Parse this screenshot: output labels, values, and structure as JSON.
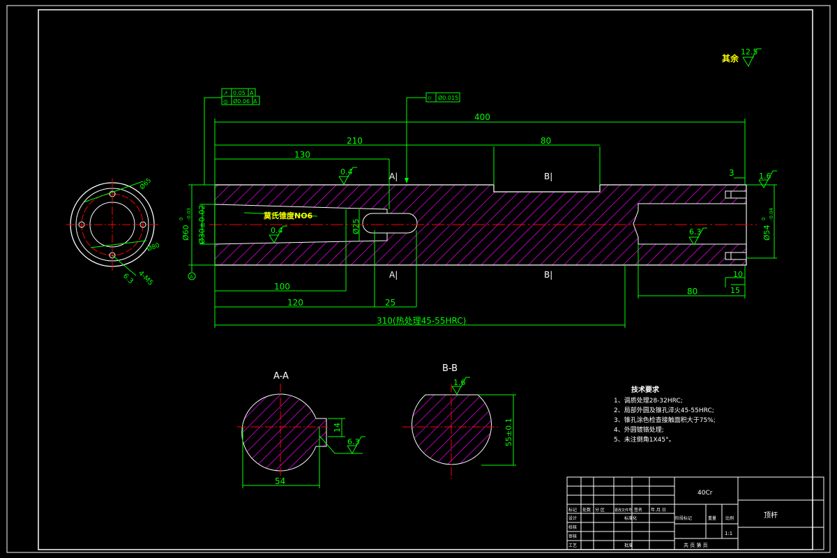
{
  "roughness_other": {
    "label": "其余",
    "value": "12.5"
  },
  "gdt": {
    "frame1": {
      "sym": "↗",
      "tol": "0.05",
      "datum": "A"
    },
    "frame2": {
      "sym": "◎",
      "tol": "Ø0.06",
      "datum": "A"
    },
    "frame3": {
      "sym": "⌭",
      "tol": "Ø0.015"
    }
  },
  "dims": {
    "d400": "400",
    "d210": "210",
    "d80_top": "80",
    "d130": "130",
    "d3": "3",
    "d100": "100",
    "d120": "120",
    "d25": "25",
    "d310": "310(热处理45-55HRC)",
    "d80_bottom": "80",
    "d10": "10",
    "d15": "15",
    "dia60": "Ø60",
    "dia60_tol_up": "0",
    "dia60_tol_dn": "-0.03",
    "dia30": "Ø30±0.02",
    "dia25": "Ø25",
    "dia54": "Ø54",
    "dia54_tol_up": "0",
    "dia54_tol_dn": "-0.04",
    "datum_a": "A",
    "morse": "莫氏锥度NO6",
    "ra04_top": "0.4",
    "ra04_mid": "0.4",
    "ra16": "1.6",
    "ra63": "6.3"
  },
  "section_marks": {
    "a_top": "A|",
    "a_bot": "A|",
    "b_top": "B|",
    "b_bot": "B|",
    "b_label": "B|"
  },
  "end_view": {
    "d65": "Ø65",
    "d80": "Ø80",
    "m5": "4-M5",
    "ra": "6.3"
  },
  "section_aa": {
    "title": "A-A",
    "w": "54",
    "h": "14",
    "ra": "6.3"
  },
  "section_bb": {
    "title": "B-B",
    "h": "55±0.1",
    "ra": "1.6"
  },
  "tech_req": {
    "title": "技术要求",
    "items": [
      "1、调质处理28-32HRC;",
      "2、局部外圆及锥孔淬火45-55HRC;",
      "3、锥孔涂色检查接触面积大于75%;",
      "4、外圆镀铬处理;",
      "5、未注倒角1X45°。"
    ]
  },
  "title_block": {
    "material": "40Cr",
    "part_name": "顶杆",
    "scale": "1:1",
    "sheet": "共 页 第 页",
    "rows": [
      "标记",
      "设计",
      "校核",
      "审核",
      "工艺"
    ],
    "cols": [
      "处数",
      "分 区",
      "更改文件号",
      "签名",
      "年.月.日"
    ],
    "std": "标准化",
    "approve": "批准",
    "stage": "阶段标记",
    "weight": "重量",
    "ratio": "比例"
  },
  "colors": {
    "outline": "#ffffff",
    "dim": "#00ff00",
    "hatch": "#ff00ff",
    "center": "#ff0000",
    "note": "#ffff00"
  }
}
